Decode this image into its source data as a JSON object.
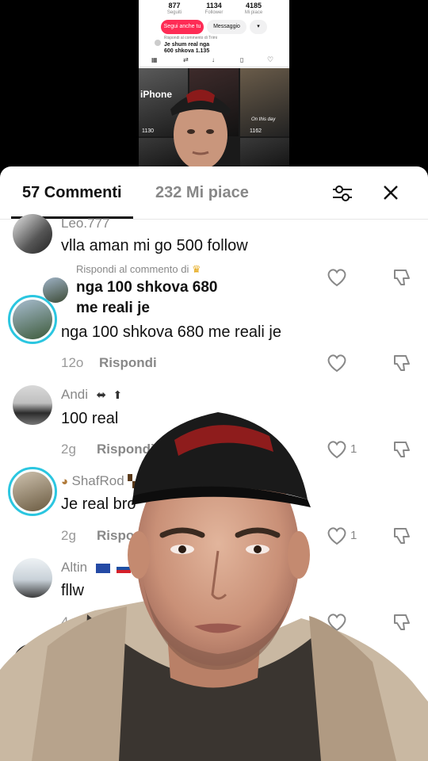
{
  "profile_preview": {
    "stats": [
      {
        "value": "877",
        "label": "Seguiti"
      },
      {
        "value": "1134",
        "label": "Follower"
      },
      {
        "value": "4185",
        "label": "Mi piace"
      }
    ],
    "follow_back_label": "Segui anche tu",
    "message_label": "Messaggio",
    "reply_to": "Rispondi al commento di Trimi",
    "quoted_comment": "Je shum real nga 600 shkova 1.135",
    "grid_tiles": [
      {
        "label": "iPhone",
        "views": "1130"
      },
      {
        "label": "On this day",
        "views": "1162"
      }
    ]
  },
  "sheet": {
    "tabs": [
      {
        "label": "57 Commenti",
        "active": true
      },
      {
        "label": "232 Mi piace",
        "active": false
      }
    ]
  },
  "reply_prompt": {
    "text": "Rispondi al commento di",
    "quote_line1": "nga 100 shkova 680",
    "quote_line2": "me reali je"
  },
  "comments": [
    {
      "username": "Leo.777",
      "text": "vlla aman mi go 500 follow",
      "meta": "",
      "reply_label": "",
      "likes": ""
    },
    {
      "username": "",
      "text": "nga 100 shkova 680 me reali je",
      "meta": "12o",
      "reply_label": "Rispondi",
      "likes": ""
    },
    {
      "username": "Andi",
      "text": "100 real",
      "meta": "2g",
      "reply_label": "Rispondi",
      "likes": "1"
    },
    {
      "username": "ShafRod",
      "text": "Je real bro",
      "meta": "2g",
      "reply_label": "Rispo",
      "likes": "1"
    },
    {
      "username": "Altin",
      "text": "fllw",
      "meta": "4",
      "reply_label": "",
      "likes": ""
    }
  ],
  "colors": {
    "accent": "#fe2c55",
    "ring": "#2bc6e0",
    "text": "#111111",
    "muted": "#888888"
  }
}
